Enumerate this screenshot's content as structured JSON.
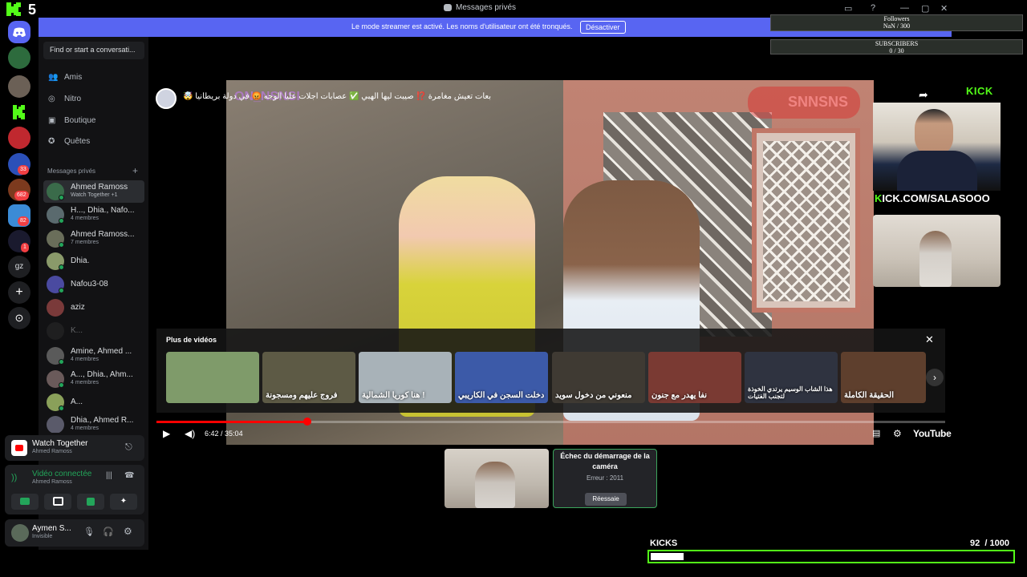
{
  "window": {
    "title": "Messages privés",
    "kick_number": "5"
  },
  "banner": {
    "message": "Le mode streamer est activé. Les noms d'utilisateur ont été tronqués.",
    "button": "Désactiver"
  },
  "overlays": {
    "followers_label": "Followers",
    "followers_value": "NaN / 300",
    "subscribers_label": "SUBSCRIBERS",
    "subscribers_value": "0 / 30",
    "kick_logo": "KICK",
    "kick_url_prefix": "K",
    "kick_url": "ICK.COM/SALASOOO",
    "kicks_label": "KICKS",
    "kicks_current": "92",
    "kicks_total": "/ 1000",
    "kicks_progress": 0.092
  },
  "rail": {
    "badges": [
      "33",
      "682",
      "82",
      "1"
    ],
    "gz_label": "gz"
  },
  "sidebar": {
    "search_placeholder": "Find or start a conversati...",
    "nav": [
      {
        "label": "Amis",
        "icon": "friends-icon"
      },
      {
        "label": "Nitro",
        "icon": "nitro-icon"
      },
      {
        "label": "Boutique",
        "icon": "shop-icon"
      },
      {
        "label": "Quêtes",
        "icon": "quests-icon"
      }
    ],
    "section_label": "Messages privés",
    "dms": [
      {
        "name": "Ahmed Ramoss",
        "sub": "Watch Together +1",
        "active": true
      },
      {
        "name": "H..., Dhia., Nafo...",
        "sub": "4 membres"
      },
      {
        "name": "Ahmed Ramoss...",
        "sub": "7 membres"
      },
      {
        "name": "Dhia.",
        "sub": ""
      },
      {
        "name": "Nafou3-08",
        "sub": ""
      },
      {
        "name": "aziz",
        "sub": ""
      },
      {
        "name": "K...",
        "sub": ""
      },
      {
        "name": "Amine, Ahmed ...",
        "sub": "4 membres"
      },
      {
        "name": "A..., Dhia., Ahm...",
        "sub": "4 membres"
      },
      {
        "name": "A...",
        "sub": ""
      },
      {
        "name": "Dhia., Ahmed R...",
        "sub": "4 membres"
      }
    ]
  },
  "activity": {
    "title": "Watch Together",
    "host": "Ahmed Ramoss"
  },
  "voice": {
    "status": "Vidéo connectée",
    "channel": "Ahmed Ramoss"
  },
  "user": {
    "name": "Aymen S...",
    "status": "Invisible"
  },
  "video": {
    "title": "🤯 بعات تعيش مغامرة ⁉️ صيبت ليها الهبي ✅ عصابات اجلات عليا الوجه 😡 في دولة بريطانيا",
    "watermark_left": "ON_NSNSI",
    "watermark_right": "SNNSNS",
    "more_label": "Plus de vidéos",
    "thumbnails": [
      {
        "text": "",
        "color": "#7f9b6a"
      },
      {
        "text": "فروج عليهم ومسجونة",
        "color": "#5d5a45"
      },
      {
        "text": "هنا كوريا الشمالية !",
        "color": "#a8b2b8"
      },
      {
        "text": "دخلت السجن في الكاريبي",
        "color": "#3c5aa8"
      },
      {
        "text": "منعوني من دخول سويد",
        "color": "#3f3a33"
      },
      {
        "text": "نفا يهدر مع جنون",
        "color": "#7a3a33"
      },
      {
        "text": "هذا الشاب الوسيم يرتدي الخوذة لتجنب الفتيات",
        "color": "#2f3340"
      },
      {
        "text": "الحقيقة الكاملة",
        "color": "#5e3f2d"
      }
    ],
    "time_current": "6:42",
    "time_total": "35:04",
    "progress": 0.191,
    "youtube_label": "YouTube"
  },
  "camera": {
    "fail_title": "Échec du démarrage de la caméra",
    "error": "Erreur : 2011",
    "retry": "Réessaie"
  }
}
